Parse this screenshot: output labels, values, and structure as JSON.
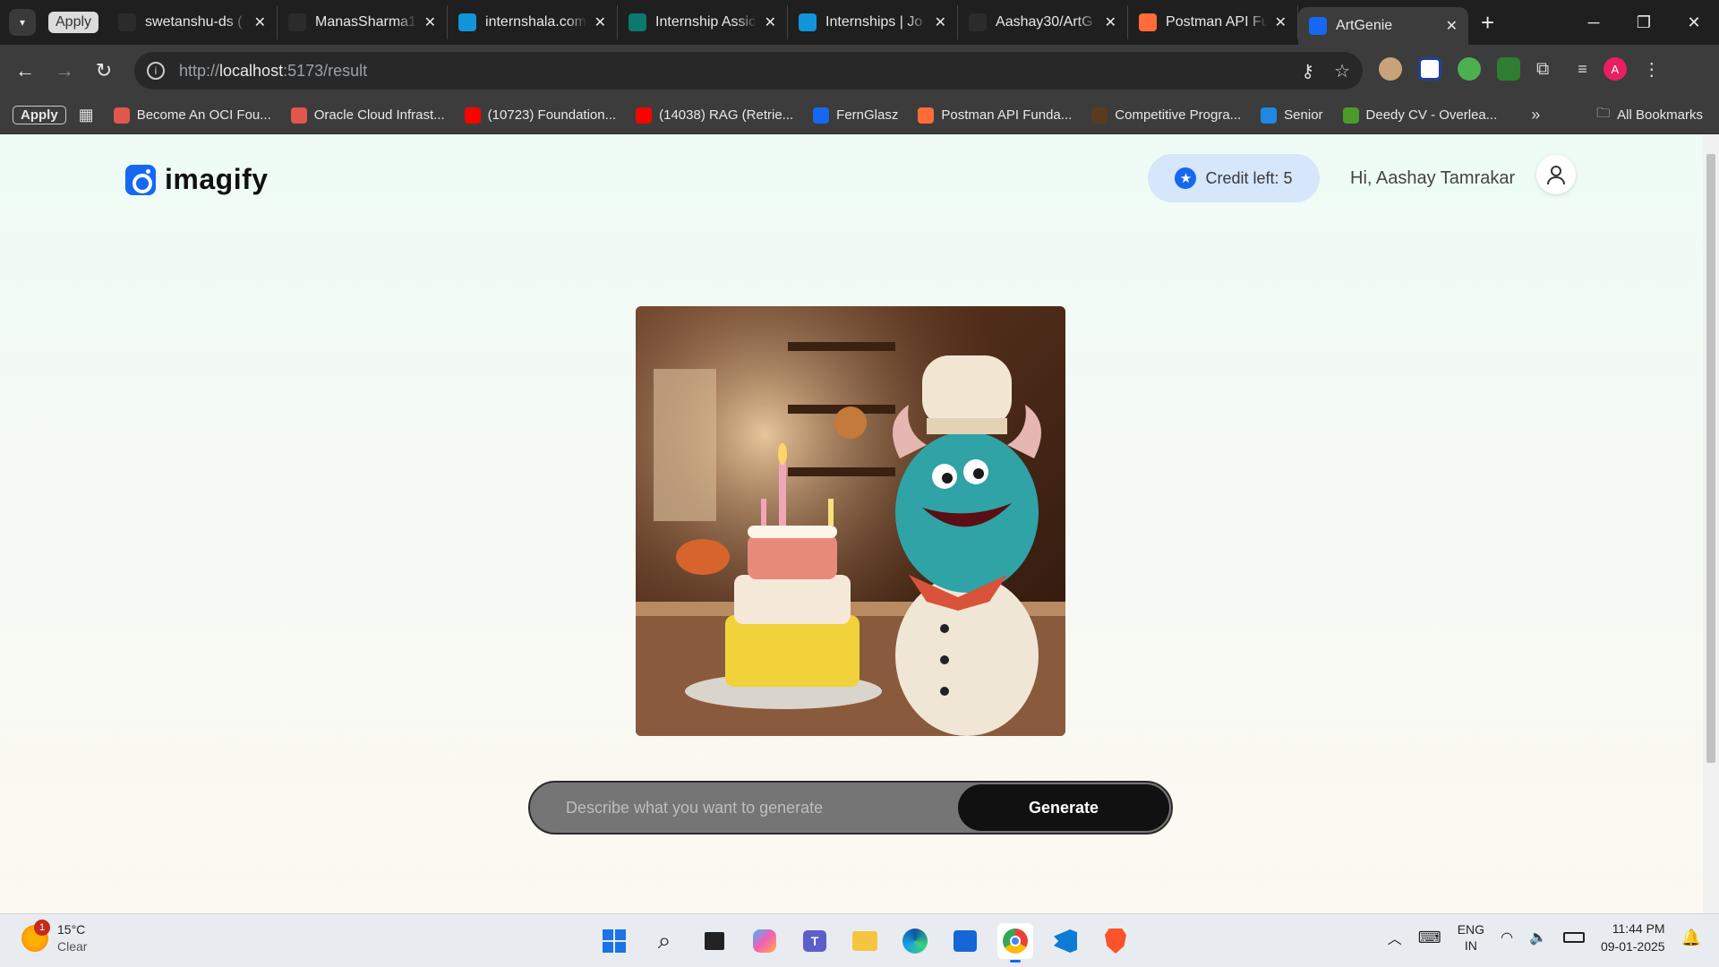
{
  "browser": {
    "apply_chip": "Apply",
    "tabs": [
      {
        "title": "swetanshu-ds (",
        "icon": "github-icon",
        "color": "#2b2b2b"
      },
      {
        "title": "ManasSharma1",
        "icon": "github-icon",
        "color": "#2b2b2b"
      },
      {
        "title": "internshala.com",
        "icon": "internshala-icon",
        "color": "#1295d8"
      },
      {
        "title": "Internship Assic",
        "icon": "forms-icon",
        "color": "#0b7a6e"
      },
      {
        "title": "Internships | Jo",
        "icon": "internshala-icon",
        "color": "#1295d8"
      },
      {
        "title": "Aashay30/ArtG",
        "icon": "github-icon",
        "color": "#2b2b2b"
      },
      {
        "title": "Postman API Fu",
        "icon": "postman-icon",
        "color": "#ff6c37"
      },
      {
        "title": "ArtGenie",
        "icon": "imagify-icon",
        "color": "#1668f0",
        "active": true
      }
    ],
    "url": {
      "proto": "http://",
      "host": "localhost",
      "rest": ":5173/result"
    },
    "bookmarks": {
      "apply": "Apply",
      "items": [
        {
          "label": "Become An OCI Fou...",
          "icon": "oracle-icon",
          "color": "#e2574c"
        },
        {
          "label": "Oracle Cloud Infrast...",
          "icon": "oracle-icon",
          "color": "#e2574c"
        },
        {
          "label": "(10723) Foundation...",
          "icon": "youtube-icon",
          "color": "#ff0000"
        },
        {
          "label": "(14038) RAG (Retrie...",
          "icon": "youtube-icon",
          "color": "#ff0000"
        },
        {
          "label": "FernGlasz",
          "icon": "fernglasz-icon",
          "color": "#1668f0"
        },
        {
          "label": "Postman API Funda...",
          "icon": "postman-icon",
          "color": "#ff6c37"
        },
        {
          "label": "Competitive Progra...",
          "icon": "cc-icon",
          "color": "#5a3b1e"
        },
        {
          "label": "Senior",
          "icon": "s-icon",
          "color": "#1e88e5"
        },
        {
          "label": "Deedy CV - Overlea...",
          "icon": "overleaf-icon",
          "color": "#4c9a2a"
        }
      ],
      "all_bookmarks": "All Bookmarks"
    }
  },
  "app": {
    "logo_text": "imagify",
    "credit_label": "Credit left: 5",
    "greeting": "Hi, Aashay Tamrakar",
    "prompt_placeholder": "Describe what you want to generate",
    "prompt_value": "",
    "generate_label": "Generate"
  },
  "taskbar": {
    "temp": "15°C",
    "condition": "Clear",
    "weather_badge": "1",
    "lang_top": "ENG",
    "lang_bottom": "IN",
    "time": "11:44 PM",
    "date": "09-01-2025"
  }
}
